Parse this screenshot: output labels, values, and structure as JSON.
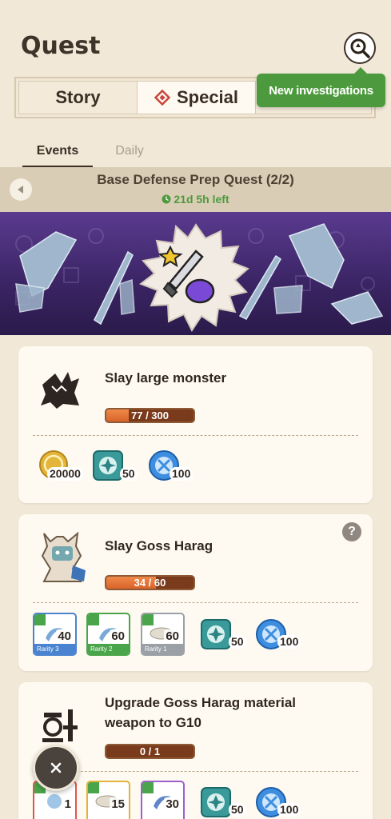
{
  "header": {
    "title": "Quest"
  },
  "tabs": {
    "story": "Story",
    "special": "Special"
  },
  "tooltip": "New investigations",
  "subtabs": {
    "events": "Events",
    "daily": "Daily"
  },
  "event": {
    "title": "Base Defense Prep Quest (2/2)",
    "time_left": "21d 5h left"
  },
  "quests": [
    {
      "title": "Slay large monster",
      "progress_text": "77 / 300",
      "progress": 0.257,
      "rewards": [
        "20000",
        "50",
        "100"
      ]
    },
    {
      "title": "Slay Goss Harag",
      "progress_text": "34 / 60",
      "progress": 0.567,
      "materials": [
        {
          "qty": "40",
          "rarity": "Rarity 3"
        },
        {
          "qty": "60",
          "rarity": "Rarity 2"
        },
        {
          "qty": "60",
          "rarity": "Rarity 1"
        }
      ],
      "rewards": [
        "50",
        "100"
      ]
    },
    {
      "title_line1": "Upgrade Goss Harag material",
      "title_line2": "weapon to G10",
      "progress_text": "0 / 1",
      "progress": 0,
      "materials": [
        {
          "qty": "1"
        },
        {
          "qty": "15"
        },
        {
          "qty": "30"
        }
      ],
      "rewards": [
        "50",
        "100"
      ]
    }
  ],
  "colors": {
    "background": "#f1e8d8",
    "accent_green": "#4d9a3e",
    "progress_orange": "#e0703a",
    "rarity3": "#4a84d0",
    "rarity2": "#4aa54a",
    "rarity1": "#9aa0a6"
  },
  "icons": {
    "search": "search-icon",
    "close": "close-icon",
    "help": "help-icon",
    "back": "back-arrow-icon"
  }
}
